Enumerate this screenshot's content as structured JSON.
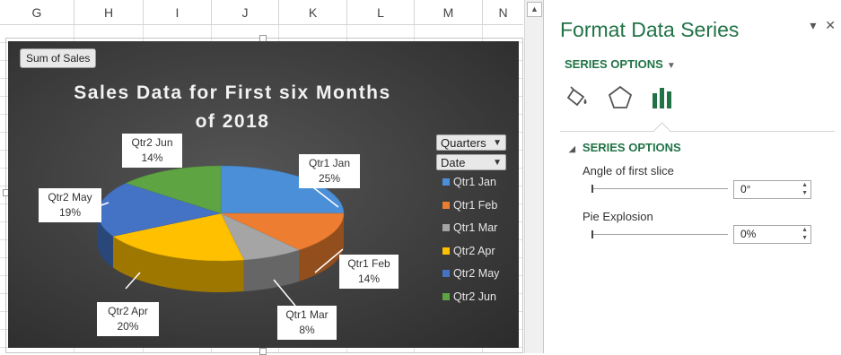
{
  "columns": [
    "G",
    "H",
    "I",
    "J",
    "K",
    "L",
    "M",
    "N"
  ],
  "vscroll": {
    "up_arrow": "▲"
  },
  "chart": {
    "sum_button": "Sum of Sales",
    "filter_buttons": [
      {
        "label": "Quarters"
      },
      {
        "label": "Date"
      }
    ],
    "data_labels": [
      {
        "line1": "Qtr1 Jan",
        "line2": "25%"
      },
      {
        "line1": "Qtr1 Feb",
        "line2": "14%"
      },
      {
        "line1": "Qtr1 Mar",
        "line2": "8%"
      },
      {
        "line1": "Qtr2 Apr",
        "line2": "20%"
      },
      {
        "line1": "Qtr2 May",
        "line2": "19%"
      },
      {
        "line1": "Qtr2 Jun",
        "line2": "14%"
      }
    ]
  },
  "chart_data": {
    "type": "pie",
    "title": "Sales Data for First six Months of 2018",
    "categories": [
      "Qtr1 Jan",
      "Qtr1 Feb",
      "Qtr1 Mar",
      "Qtr2 Apr",
      "Qtr2 May",
      "Qtr2 Jun"
    ],
    "values": [
      25,
      14,
      8,
      20,
      19,
      14
    ],
    "colors": [
      "#4a8fd8",
      "#ed7d31",
      "#a5a5a5",
      "#ffc000",
      "#4472c4",
      "#5fa443"
    ],
    "legend_position": "right",
    "three_d": true
  },
  "pane": {
    "title": "Format Data Series",
    "pin_icon": "▾",
    "close_icon": "✕",
    "series_options_dropdown": "SERIES OPTIONS",
    "tabs": [
      "fill-line-icon",
      "effects-icon",
      "series-options-icon"
    ],
    "section_title": "SERIES OPTIONS",
    "angle_label": "Angle of first slice",
    "angle_value": "0°",
    "explosion_label": "Pie Explosion",
    "explosion_value": "0%"
  }
}
